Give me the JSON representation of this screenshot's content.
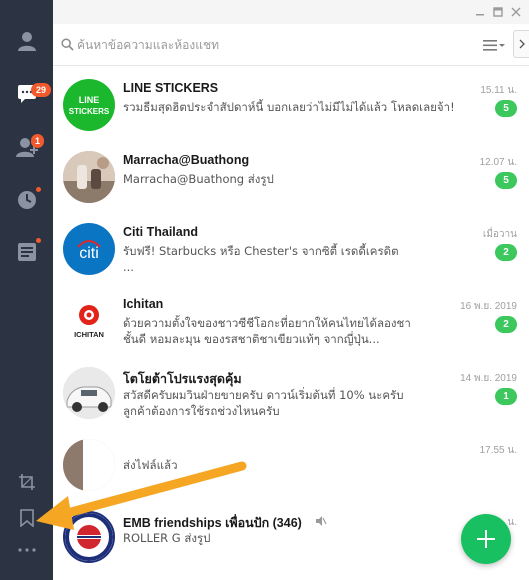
{
  "sidebar": {
    "chats_badge": "29",
    "friends_badge": "1"
  },
  "search": {
    "placeholder": "ค้นหาข้อความและห้องแชท"
  },
  "chats": [
    {
      "name": "LINE STICKERS",
      "message": "รวมธีมสุดฮิตประจำสัปดาห์นี้ บอกเลยว่าไม่มีไม่ได้แล้ว โหลดเลยจ้า!",
      "time": "15.11 น.",
      "unread": "5",
      "avatar_text": "LINE\nSTICKERS"
    },
    {
      "name": "Marracha@Buathong",
      "message": "Marracha@Buathong ส่งรูป",
      "time": "12.07 น.",
      "unread": "5"
    },
    {
      "name": "Citi Thailand",
      "message": "รับฟรี! Starbucks หรือ Chester's จากซิตี้ เรดดี้เครดิต ...",
      "time": "เมื่อวาน",
      "unread": "2",
      "avatar_text": "citi"
    },
    {
      "name": "Ichitan",
      "message": "ด้วยความตั้งใจของชาวซีชีโอกะที่อยากให้คนไทยได้ลองชาชั้นดี หอมละมุน ของรสชาติชาเขียวแท้ๆ จากญี่ปุ่น...",
      "time": "16 พ.ย. 2019",
      "unread": "2",
      "avatar_text": "ICHITAN"
    },
    {
      "name": "โตโยต้าโปรแรงสุดคุ้ม",
      "message": "สวัสดีครับผมวินฝ่ายขายครับ ดาวน์เริ่มต้นที่ 10% นะครับลูกค้าต้องการใช้รถช่วงไหนครับ",
      "time": "14 พ.ย. 2019",
      "unread": "1"
    },
    {
      "name": "",
      "message": "ส่งไฟล์แล้ว",
      "time": "17.55 น.",
      "unread": ""
    },
    {
      "name": "EMB friendships เพื่อนปัก (346)",
      "message": "ROLLER G ส่งรูป",
      "time": "น.",
      "unread": ""
    }
  ],
  "colors": {
    "sidebar_bg": "#2c3342",
    "badge_red": "#f15a2c",
    "unread_green": "#3dc85d",
    "fab_green": "#19c061",
    "arrow_orange": "#f5a623"
  }
}
